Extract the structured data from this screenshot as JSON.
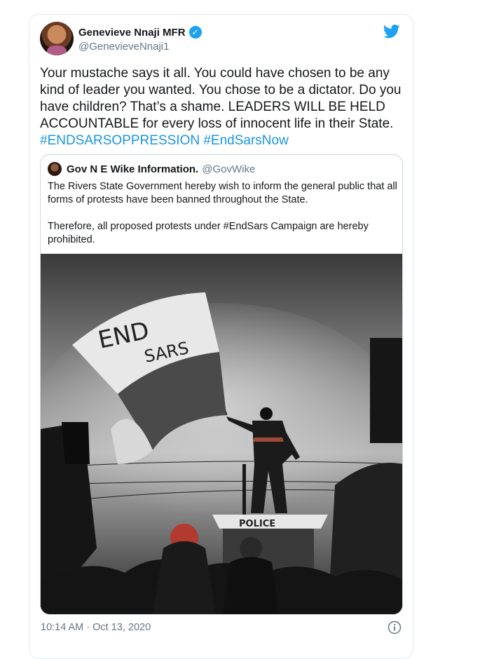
{
  "tweet": {
    "display_name": "Genevieve Nnaji MFR",
    "handle": "@GenevieveNnaji1",
    "text_lines": [
      "Your mustache says it all. You could have chosen to be any",
      "kind of leader you wanted. You chose to be a dictator. Do you",
      "have children? That’s a shame. LEADERS WILL BE HELD",
      "ACCOUNTABLE for every loss of innocent life in their State."
    ],
    "hashtags": [
      "#ENDSARSOPPRESSION",
      "#EndSarsNow"
    ],
    "timestamp": "10:14 AM · Oct 13, 2020",
    "icons": {
      "verified": "verified-badge-icon",
      "brand": "twitter-bird-icon",
      "info": "info-icon"
    },
    "colors": {
      "accent": "#1da1f2",
      "link": "#1b95e0",
      "muted": "#657786"
    }
  },
  "quoted_tweet": {
    "display_name": "Gov N E Wike Information.",
    "handle": "@GovWike",
    "paragraphs": [
      "The Rivers State Government hereby wish to inform the general public that all forms of protests have been banned throughout the State.",
      "Therefore, all proposed protests under #EndSars Campaign are hereby prohibited."
    ],
    "image": {
      "flag_text_line1": "END",
      "flag_text_line2": "SARS",
      "sign_text": "POLICE"
    }
  }
}
